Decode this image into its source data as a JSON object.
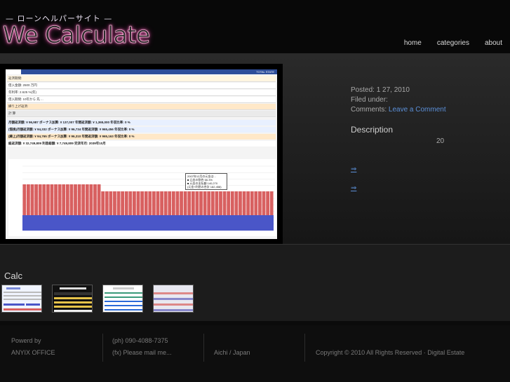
{
  "header": {
    "tagline": "— ローンヘルパーサイト —",
    "logo": "We Calculate",
    "nav": [
      {
        "label": "home"
      },
      {
        "label": "categories"
      },
      {
        "label": "about"
      }
    ]
  },
  "post": {
    "posted_label": "Posted: 1 27, 2010",
    "filed_label": "Filed under:",
    "comments_label": "Comments:",
    "comments_link": "Leave a Comment",
    "description_title": "Description",
    "description_number": "20",
    "arrow_1": "⇒",
    "arrow_2": "⇒"
  },
  "screenshot": {
    "right_tabs": "TOTAL  STATE",
    "form_rows": [
      {
        "label": "返済期間:",
        "tail": "",
        "bg": "#fff5e0"
      },
      {
        "label": "借入金額:   2500   万円",
        "tail": "",
        "bg": "#ffffff"
      },
      {
        "label": "年利率:  2.625  %(年)",
        "tail": "",
        "bg": "#ffffff"
      },
      {
        "label": "借入期間:  10年から 先 ...",
        "tail": "",
        "bg": "#ffffff"
      },
      {
        "label": "繰り上げ返済:",
        "tail": "",
        "bg": "#ffe8c8"
      },
      {
        "label": "計 算",
        "tail": "",
        "bg": "#eaeaea"
      }
    ],
    "result_rows": [
      {
        "label": "月額返済額: ¥ 96,987    ボーナス加算: ¥ 137,007    年間返済額: ¥ 1,365,000    年収比率:  0 %",
        "bg": "#e8f0ff"
      },
      {
        "label": "(借換)月額返済額: ¥ 94,332   ボーナス加算: ¥ 96,734   年間返済額: ¥ 965,456   年収比率:  0 %",
        "bg": "#e8f0ff"
      },
      {
        "label": "(繰上)月額返済額: ¥ 94,765   ボーナス加算: ¥ 96,310   年間返済額: ¥ 965,163   年収比率:  0 %",
        "bg": "#ffe8c8"
      },
      {
        "label": "総返済額: ¥ 32,749,809   利息総額: ¥ 7,749,809   完済年月: 2039年10月",
        "bg": "#ffffff"
      }
    ],
    "popup_lines": [
      "2007年12月の元金は...",
      "■ 元金の割合 66.3%",
      "■ 元金の支払額 140,270",
      "(元金+利息の合計 182,458)"
    ]
  },
  "calc": {
    "title": "Calc"
  },
  "footer": {
    "powered_by": "Powerd by",
    "company": "ANYIX OFFICE",
    "phone": "(ph) 090-4088-7375",
    "fax": "(fx) Please mail me...",
    "location": "Aichi / Japan",
    "copyright": "Copyright © 2010 All Rights Reserved · Digital Estate"
  },
  "colors": {
    "accent_link": "#5b8fd8",
    "logo_glow": "#e060a8",
    "bar_blue": "#4a56c8",
    "bar_red": "#d86060"
  }
}
